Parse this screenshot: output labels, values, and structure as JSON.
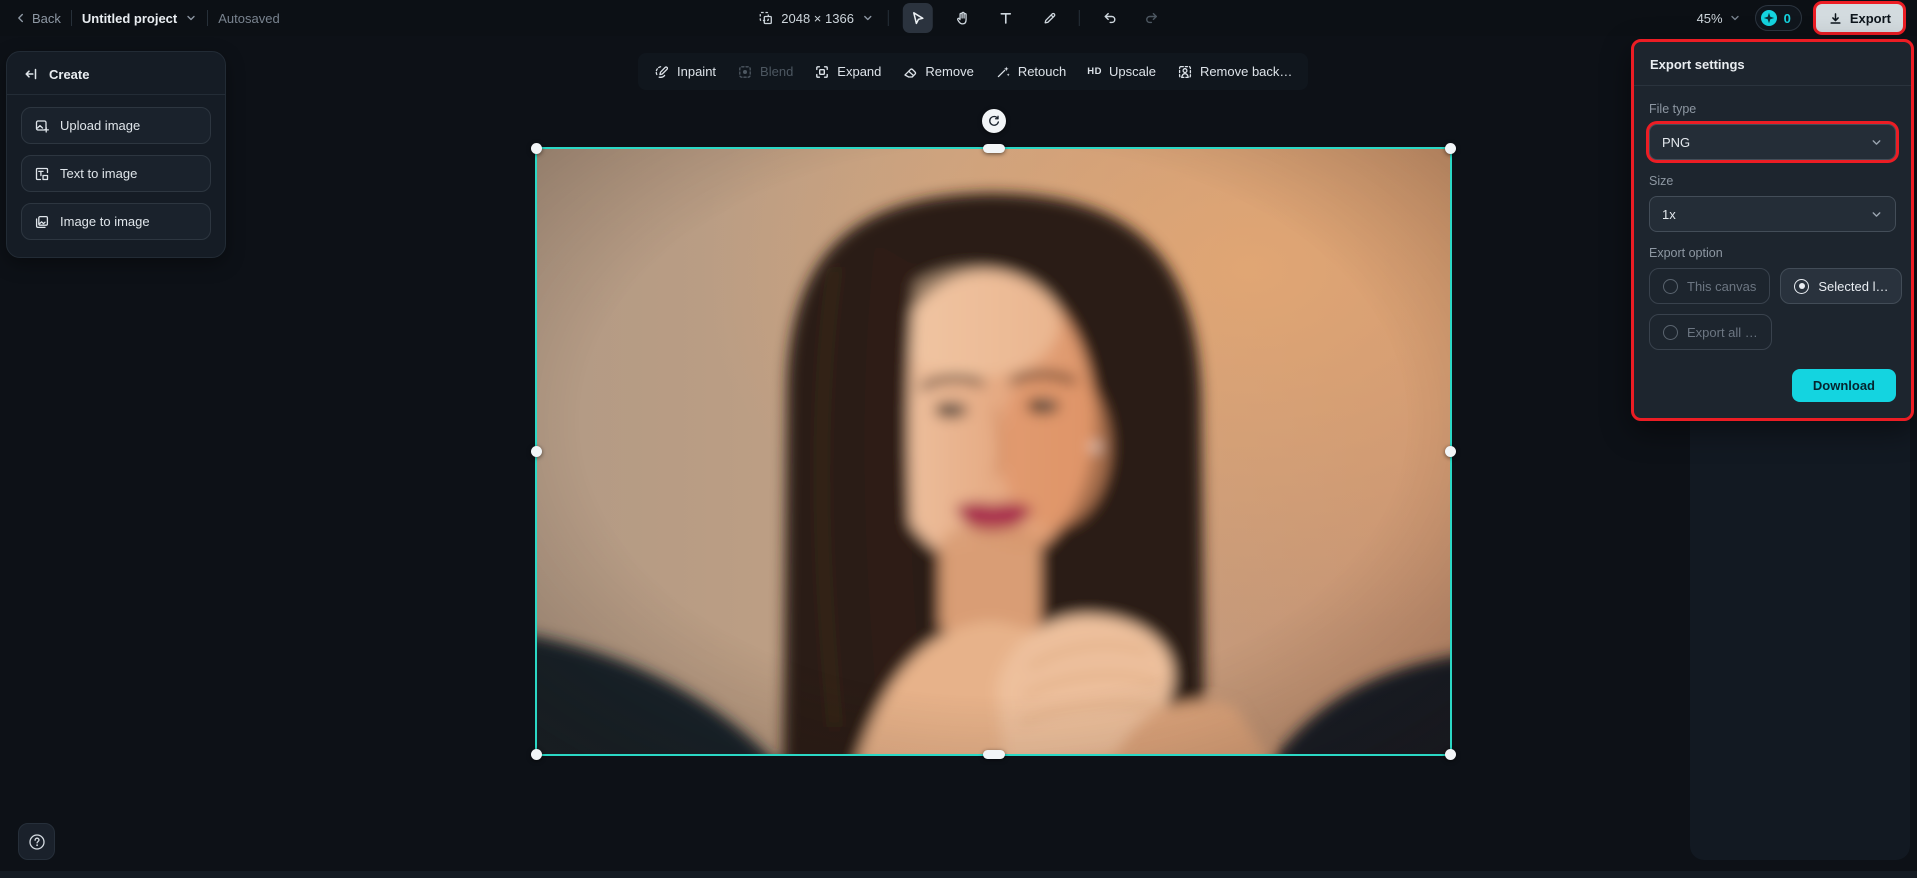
{
  "topbar": {
    "back": "Back",
    "project_name": "Untitled project",
    "autosaved": "Autosaved",
    "canvas_size": "2048 × 1366",
    "zoom": "45%",
    "credits": "0",
    "export": "Export"
  },
  "sidebar": {
    "title": "Create",
    "items": [
      {
        "label": "Upload image",
        "icon": "upload-image-icon"
      },
      {
        "label": "Text to image",
        "icon": "text-to-image-icon"
      },
      {
        "label": "Image to image",
        "icon": "image-to-image-icon"
      }
    ]
  },
  "edit_toolbar": {
    "items": [
      {
        "label": "Inpaint",
        "icon": "inpaint-icon",
        "disabled": false
      },
      {
        "label": "Blend",
        "icon": "blend-icon",
        "disabled": true
      },
      {
        "label": "Expand",
        "icon": "expand-icon",
        "disabled": false
      },
      {
        "label": "Remove",
        "icon": "eraser-icon",
        "disabled": false
      },
      {
        "label": "Retouch",
        "icon": "wand-icon",
        "disabled": false
      },
      {
        "label": "Upscale",
        "icon": "hd-icon",
        "badge": "HD",
        "disabled": false
      },
      {
        "label": "Remove back…",
        "icon": "remove-background-icon",
        "disabled": false
      }
    ]
  },
  "export_panel": {
    "title": "Export settings",
    "file_type": {
      "label": "File type",
      "value": "PNG"
    },
    "size": {
      "label": "Size",
      "value": "1x"
    },
    "export_option": {
      "label": "Export option",
      "options": [
        {
          "label": "This canvas",
          "selected": false
        },
        {
          "label": "Selected l…",
          "selected": true
        },
        {
          "label": "Export all …",
          "selected": false
        }
      ]
    },
    "download": "Download"
  },
  "colors": {
    "accent_cyan": "#14d4e0",
    "selection_teal": "#2bd8c5",
    "annotation_red": "#ec1d24"
  }
}
